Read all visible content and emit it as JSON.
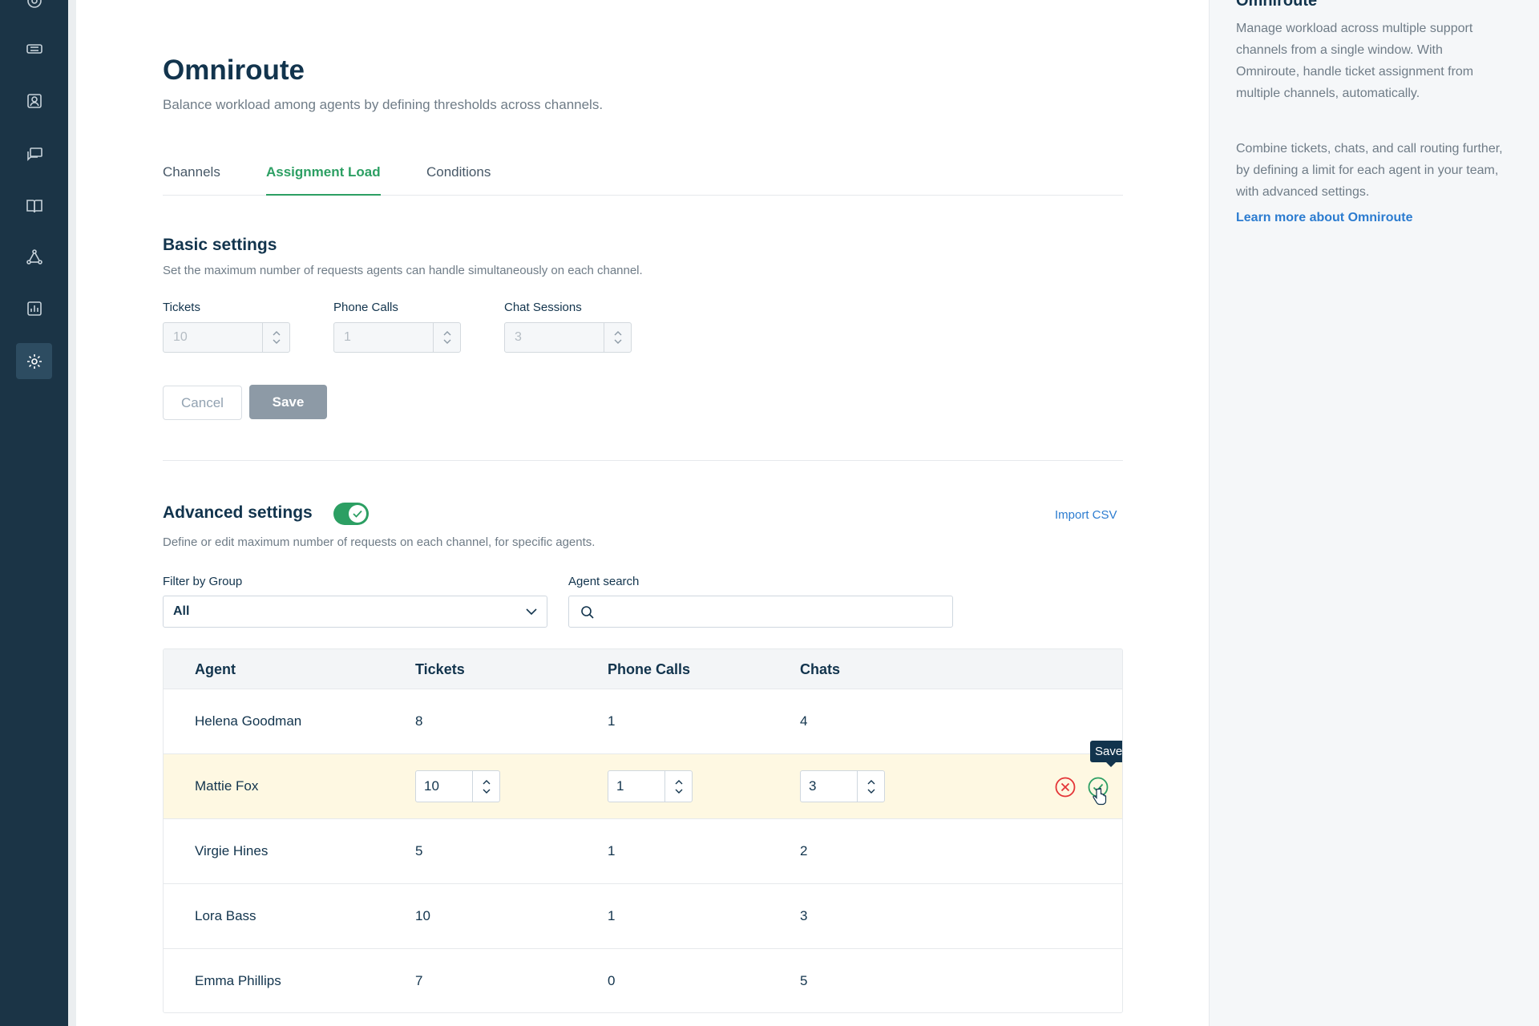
{
  "nav": {
    "items": [
      {
        "icon": "home-icon"
      },
      {
        "icon": "ticket-icon"
      },
      {
        "icon": "contact-icon"
      },
      {
        "icon": "chat-icon"
      },
      {
        "icon": "book-icon"
      },
      {
        "icon": "network-icon"
      },
      {
        "icon": "report-icon"
      },
      {
        "icon": "gear-icon",
        "active": true
      }
    ]
  },
  "page": {
    "title": "Omniroute",
    "subtitle": "Balance workload among agents by defining thresholds across channels."
  },
  "tabs": [
    {
      "label": "Channels"
    },
    {
      "label": "Assignment Load",
      "active": true
    },
    {
      "label": "Conditions"
    }
  ],
  "basic": {
    "title": "Basic settings",
    "description": "Set the maximum number of requests agents can handle simultaneously on each channel.",
    "fields": [
      {
        "label": "Tickets",
        "value": "10"
      },
      {
        "label": "Phone Calls",
        "value": "1"
      },
      {
        "label": "Chat Sessions",
        "value": "3"
      }
    ],
    "cancel_label": "Cancel",
    "save_label": "Save"
  },
  "advanced": {
    "title": "Advanced settings",
    "toggle_on": true,
    "import_label": "Import CSV",
    "description": "Define or edit maximum number of requests on each channel, for specific agents.",
    "filter_label": "Filter by Group",
    "filter_value": "All",
    "search_label": "Agent search",
    "search_placeholder": ""
  },
  "table": {
    "headers": [
      "Agent",
      "Tickets",
      "Phone Calls",
      "Chats"
    ],
    "rows": [
      {
        "agent": "Helena Goodman",
        "tickets": "8",
        "calls": "1",
        "chats": "4"
      },
      {
        "agent": "Mattie Fox",
        "tickets": "10",
        "calls": "1",
        "chats": "3",
        "editing": true
      },
      {
        "agent": "Virgie Hines",
        "tickets": "5",
        "calls": "1",
        "chats": "2"
      },
      {
        "agent": "Lora Bass",
        "tickets": "10",
        "calls": "1",
        "chats": "3"
      },
      {
        "agent": "Emma Phillips",
        "tickets": "7",
        "calls": "0",
        "chats": "5"
      }
    ],
    "tooltip": "Save"
  },
  "aside": {
    "title": "Omniroute",
    "para1": "Manage workload across multiple support channels from a single window. With Omniroute, handle ticket assignment from multiple channels, automatically.",
    "para2": "Combine tickets, chats, and call routing further, by defining a limit for each agent in your team, with advanced settings.",
    "link": "Learn more about Omniroute"
  },
  "colors": {
    "nav_bg": "#1b3446",
    "accent_green": "#2c9f63",
    "link_blue": "#2c7cd0",
    "edit_row_bg": "#fef8e2",
    "cancel_red": "#e43538"
  }
}
